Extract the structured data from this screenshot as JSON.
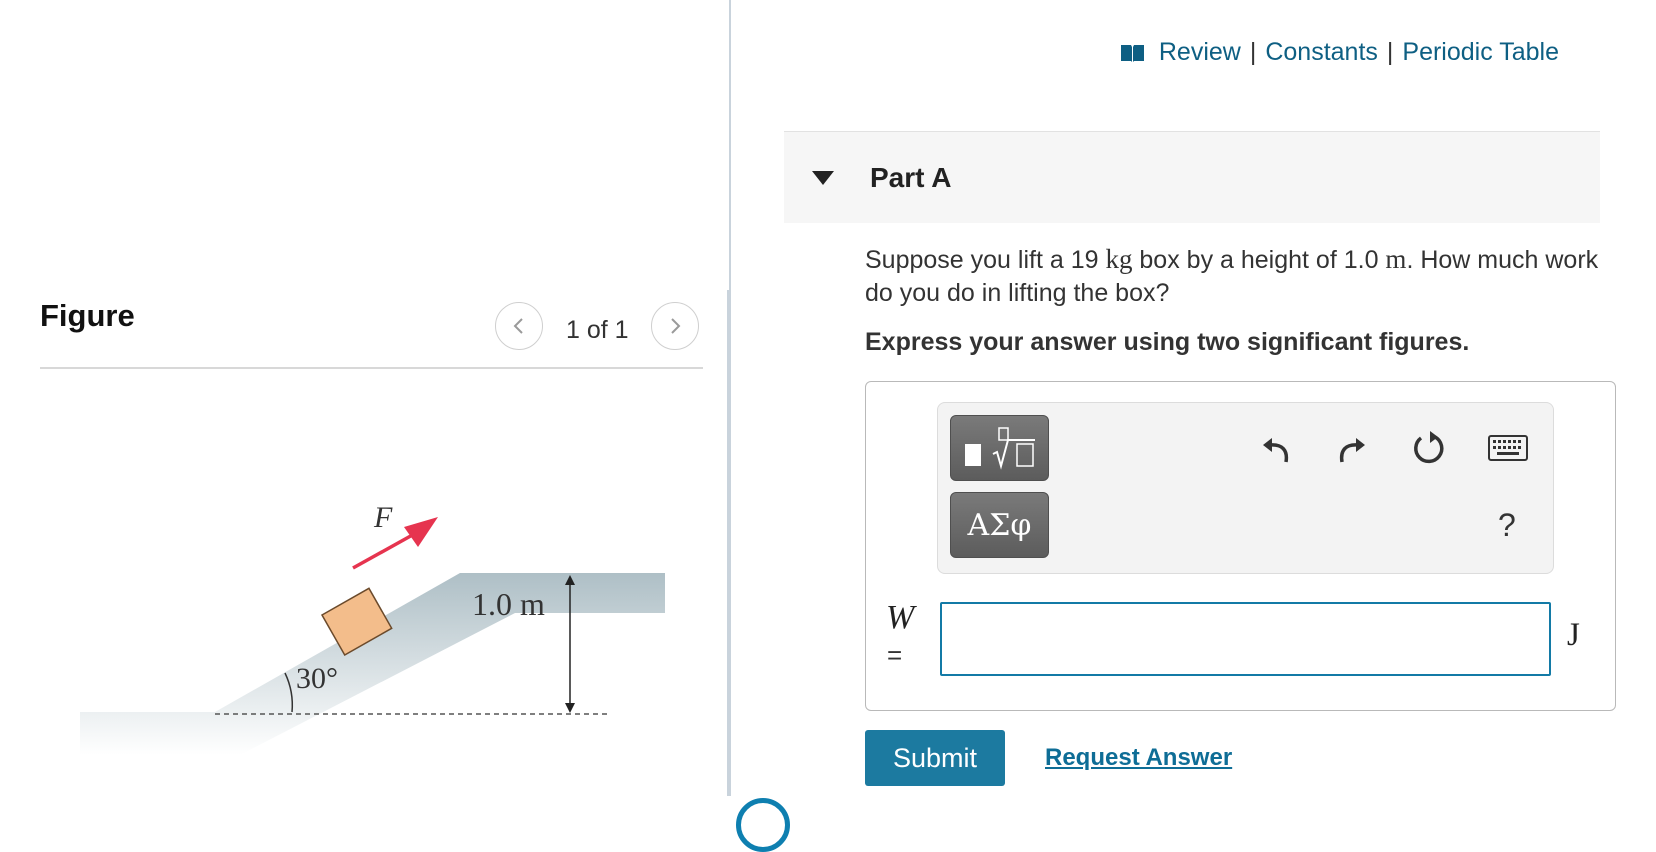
{
  "figure": {
    "heading": "Figure",
    "counter": "1 of 1",
    "labels": {
      "force": "F",
      "height": "1.0 m",
      "angle": "30°"
    }
  },
  "header_links": {
    "review": "Review",
    "constants": "Constants",
    "periodic_table": "Periodic Table",
    "separator": "|"
  },
  "part": {
    "title": "Part A"
  },
  "question": {
    "text_1": "Suppose you lift a 19",
    "mass_unit": "kg",
    "text_2": "box by a height of 1.0",
    "height_unit": "m",
    "text_3": ". How much work do you do in lifting the box?",
    "instruction": "Express your answer using two significant figures."
  },
  "toolbar": {
    "greek_label": "ΑΣφ",
    "help_label": "?"
  },
  "answer": {
    "variable": "W",
    "equals": "=",
    "value": "",
    "unit": "J"
  },
  "actions": {
    "submit": "Submit",
    "request_answer": "Request Answer"
  },
  "colors": {
    "link": "#0e5f83",
    "submit_bg": "#1c7aa0",
    "input_border": "#137aa6",
    "force_arrow": "#e6344f",
    "box_fill": "#f3bd8b"
  },
  "icons": [
    "book-icon",
    "chevron-left-icon",
    "chevron-right-icon",
    "caret-down-icon",
    "template-icon",
    "undo-icon",
    "redo-icon",
    "reset-icon",
    "keyboard-icon"
  ]
}
